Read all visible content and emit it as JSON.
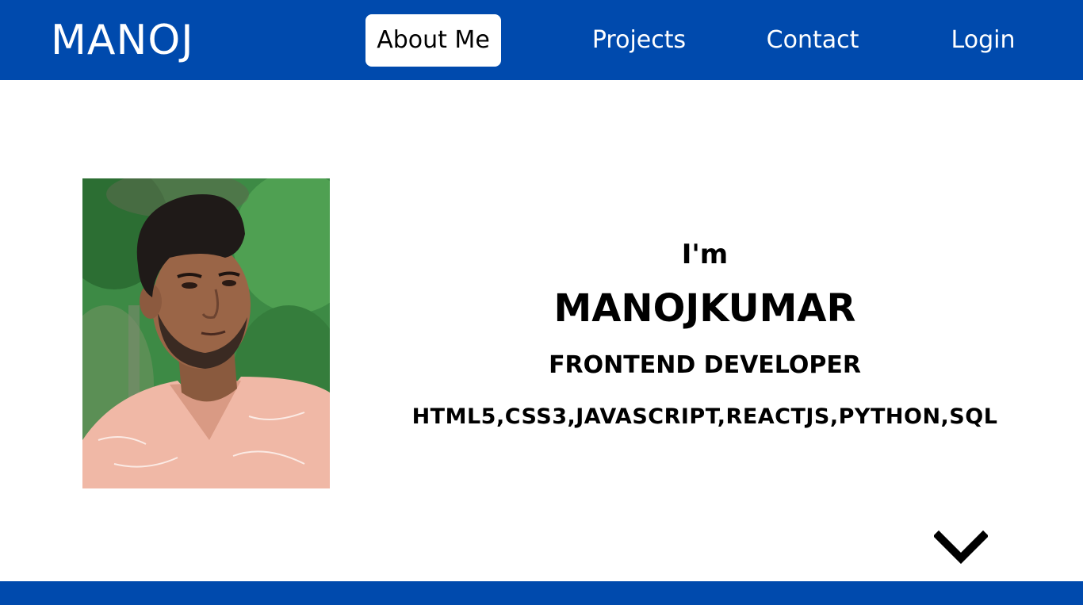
{
  "header": {
    "brand": "MANOJ",
    "nav": {
      "about": "About Me",
      "projects": "Projects",
      "contact": "Contact",
      "login": "Login"
    },
    "active_tab": "About Me"
  },
  "hero": {
    "intro": "I'm",
    "name": "MANOJKUMAR",
    "role": "FRONTEND DEVELOPER",
    "skills": "HTML5,CSS3,JAVASCRIPT,REACTJS,PYTHON,SQL"
  },
  "icons": {
    "scroll_down": "chevron-down-icon"
  },
  "colors": {
    "brand_blue": "#004aad",
    "background": "#ffffff",
    "text": "#000000"
  }
}
